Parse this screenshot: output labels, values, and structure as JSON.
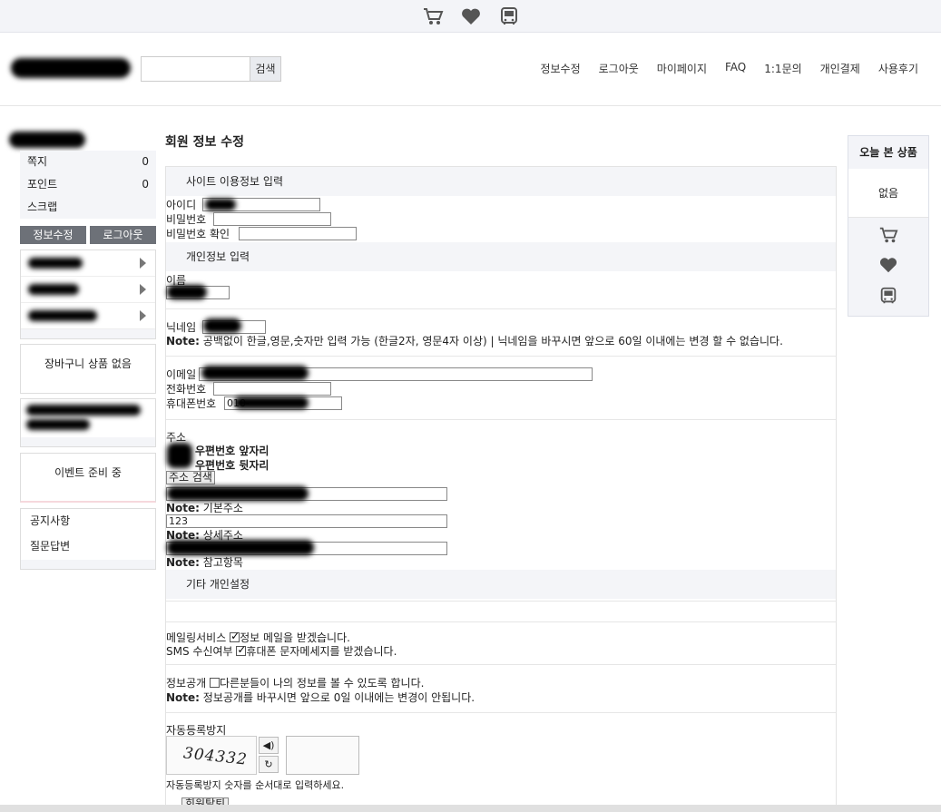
{
  "topbar": {
    "icons": [
      "cart-icon",
      "heart-icon",
      "bus-icon"
    ]
  },
  "header": {
    "search_button": "검색",
    "search_value": "",
    "nav": [
      "정보수정",
      "로그아웃",
      "마이페이지",
      "FAQ",
      "1:1문의",
      "개인결제",
      "사용후기"
    ]
  },
  "sidebar": {
    "stats": [
      {
        "label": "쪽지",
        "value": "0"
      },
      {
        "label": "포인트",
        "value": "0"
      },
      {
        "label": "스크랩",
        "value": ""
      }
    ],
    "edit_button": "정보수정",
    "logout_button": "로그아웃",
    "cart_empty": "장바구니 상품 없음",
    "event": "이벤트 준비 중",
    "board_links": [
      "공지사항",
      "질문답변"
    ]
  },
  "main": {
    "title": "회원 정보 수정",
    "sec_site": "사이트 이용정보 입력",
    "id_label": "아이디",
    "pw_label": "비밀번호",
    "pw_confirm_label": "비밀번호 확인",
    "sec_personal": "개인정보 입력",
    "name_label": "이름",
    "nick_label": "닉네임",
    "nick_note_bold": "Note:",
    "nick_note": " 공백없이 한글,영문,숫자만 입력 가능 (한글2자, 영문4자 이상) | 닉네임을 바꾸시면 앞으로 60일 이내에는 변경 할 수 없습니다.",
    "email_label": "이메일",
    "phone_label": "전화번호",
    "mobile_label": "휴대폰번호",
    "mobile_value": "010-",
    "addr_label": "주소",
    "zip1_label": "우편번호 앞자리",
    "zip2_label": "우편번호 뒷자리",
    "addr_search": "주소 검색",
    "note_bold": "Note:",
    "addr_basic": " 기본주소",
    "addr_detail_value": "123",
    "addr_detail": " 상세주소",
    "addr_ref": " 참고항목",
    "sec_other": "기타 개인설정",
    "mailing_label": "메일링서비스",
    "mailing_text": "정보 메일을 받겠습니다.",
    "sms_label": "SMS 수신여부",
    "sms_text": "휴대폰 문자메세지를 받겠습니다.",
    "open_label": "정보공개",
    "open_text": "다른분들이 나의 정보를 볼 수 있도록 합니다.",
    "open_note": " 정보공개를 바꾸시면 앞으로 0일 이내에는 변경이 안됩니다.",
    "captcha_label": "자동등록방지",
    "captcha_text": "304332",
    "captcha_hint": "자동등록방지 숫자를 순서대로 입력하세요.",
    "withdraw": "회원탈퇴"
  },
  "rightbar": {
    "title": "오늘 본 상품",
    "empty": "없음",
    "icons": [
      "cart-icon",
      "heart-icon",
      "bus-icon"
    ]
  }
}
